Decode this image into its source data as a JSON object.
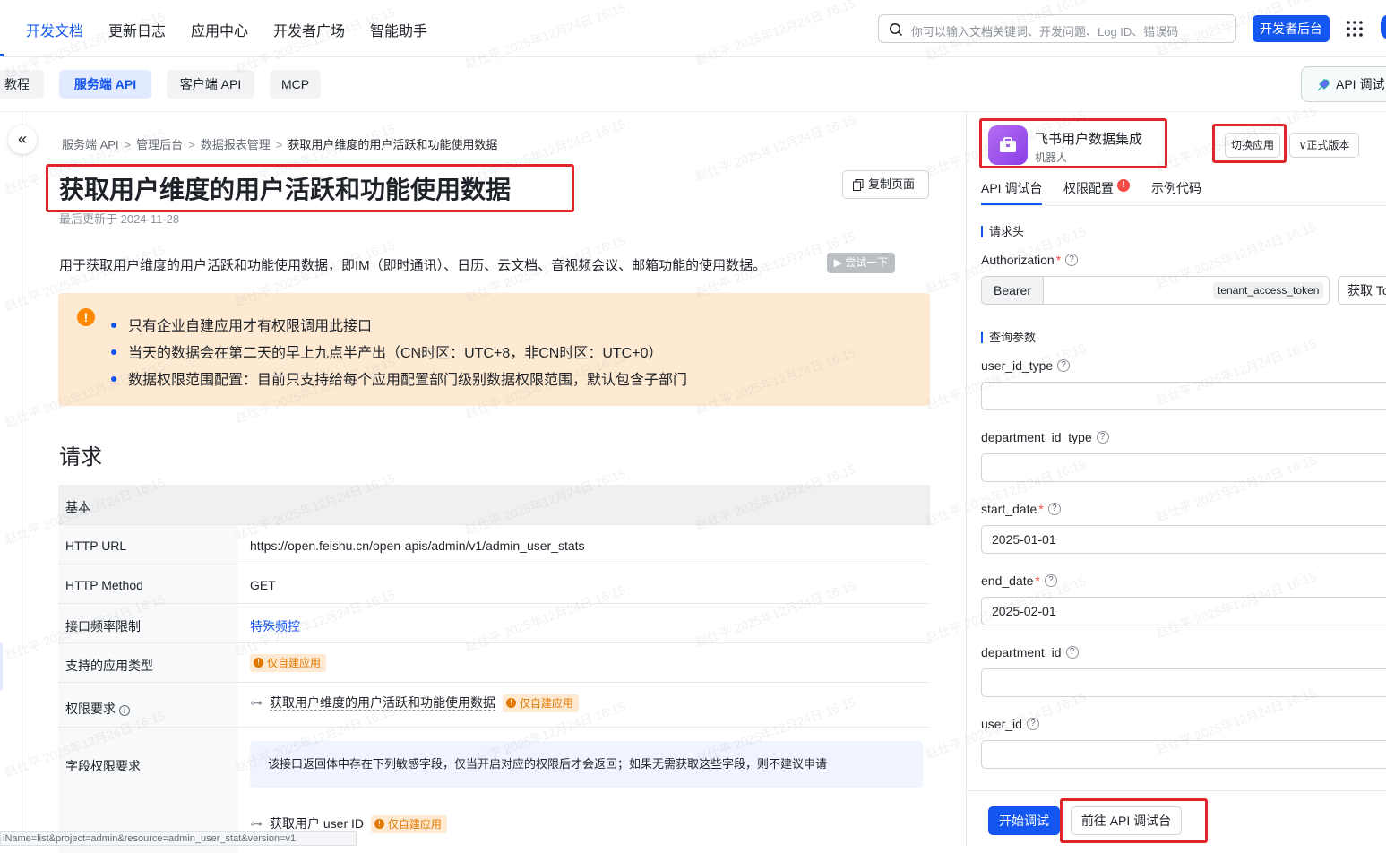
{
  "nav": {
    "items": [
      "开发文档",
      "更新日志",
      "应用中心",
      "开发者广场",
      "智能助手"
    ],
    "search_placeholder": "你可以输入文档关键词、开发问题、Log ID、错误码",
    "dev_console": "开发者后台"
  },
  "subtabs": [
    "教程",
    "服务端 API",
    "客户端 API",
    "MCP"
  ],
  "api_debug_label": "API 调试台",
  "breadcrumb": [
    "服务端 API",
    "管理后台",
    "数据报表管理",
    "获取用户维度的用户活跃和功能使用数据"
  ],
  "page": {
    "title": "获取用户维度的用户活跃和功能使用数据",
    "copy_label": "复制页面",
    "updated": "最后更新于 2024-11-28",
    "description": "用于获取用户维度的用户活跃和功能使用数据，即IM（即时通讯）、日历、云文档、音视频会议、邮箱功能的使用数据。",
    "try_label": "▶ 尝试一下",
    "warnings": [
      "只有企业自建应用才有权限调用此接口",
      "当天的数据会在第二天的早上九点半产出（CN时区：UTC+8，非CN时区：UTC+0）",
      "数据权限范围配置：目前只支持给每个应用配置部门级别数据权限范围，默认包含子部门"
    ],
    "request_title": "请求"
  },
  "request_table": {
    "header": "基本",
    "http_url_key": "HTTP URL",
    "http_url": "https://open.feishu.cn/open-apis/admin/v1/admin_user_stats",
    "http_method_key": "HTTP Method",
    "http_method": "GET",
    "rate_limit_key": "接口频率限制",
    "rate_limit": "特殊频控",
    "app_type_key": "支持的应用类型",
    "app_type_tag": "仅自建应用",
    "perm_key": "权限要求",
    "perm_value": "获取用户维度的用户活跃和功能使用数据",
    "perm_tag": "仅自建应用",
    "field_perm_key": "字段权限要求",
    "field_perm_note": "该接口返回体中存在下列敏感字段，仅当开启对应的权限后才会返回；如果无需获取这些字段，则不建议申请",
    "field_perm_value": "获取用户 user ID",
    "field_perm_tag": "仅自建应用"
  },
  "status_url": "iName=list&project=admin&resource=admin_user_stat&version=v1",
  "right_panel": {
    "app_name": "飞书用户数据集成",
    "app_type": "机器人",
    "switch_app": "切换应用",
    "version": "正式版本",
    "tabs": [
      "API 调试台",
      "权限配置",
      "示例代码"
    ],
    "headers_title": "请求头",
    "auth_label": "Authorization",
    "bearer": "Bearer",
    "token_tag": "tenant_access_token",
    "get_token": "获取 Token",
    "query_title": "查询参数",
    "fields": [
      {
        "label": "user_id_type",
        "value": "",
        "required": false
      },
      {
        "label": "department_id_type",
        "value": "",
        "required": false
      },
      {
        "label": "start_date",
        "value": "2025-01-01",
        "required": true
      },
      {
        "label": "end_date",
        "value": "2025-02-01",
        "required": true
      },
      {
        "label": "department_id",
        "value": "",
        "required": false
      },
      {
        "label": "user_id",
        "value": "",
        "required": false
      }
    ],
    "start_debug": "开始调试",
    "goto_debug": "前往 API 调试台"
  },
  "watermark": "赵仕平 2025年12月24日 16:15",
  "colors": {
    "accent": "#1456f0",
    "warning_bg": "#feead2",
    "highlight_red": "#e2242b"
  }
}
